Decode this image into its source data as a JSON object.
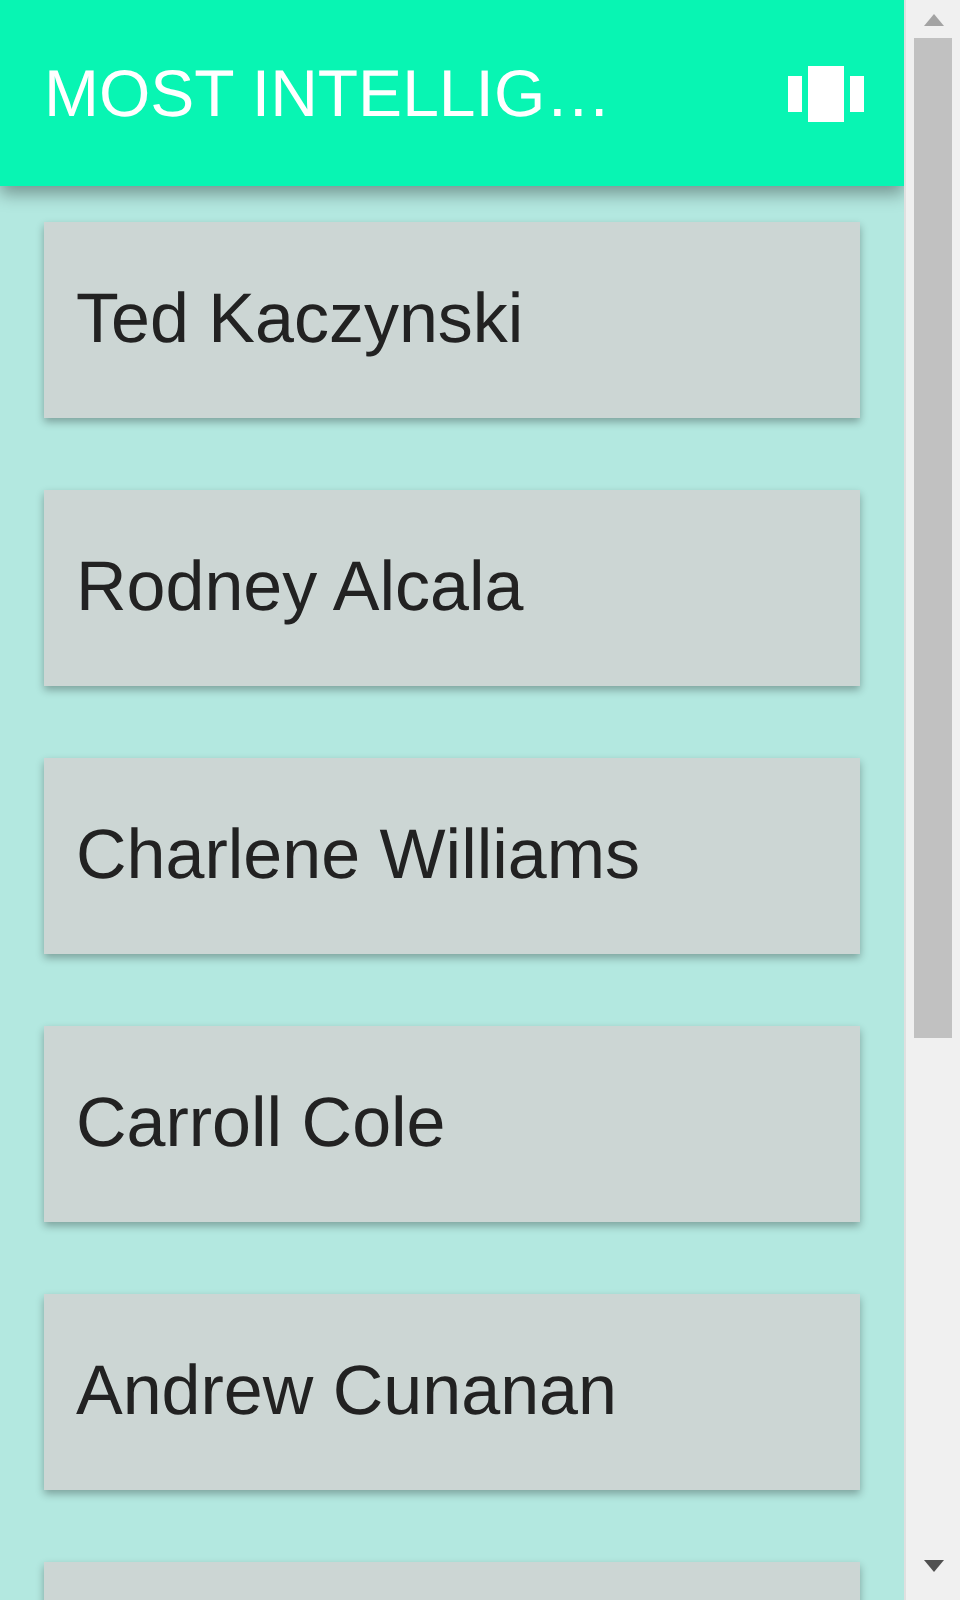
{
  "app_bar": {
    "title": "MOST INTELLIG…"
  },
  "items": [
    {
      "kind": "name",
      "name": "Ted Kaczynski"
    },
    {
      "kind": "name",
      "name": "Rodney Alcala"
    },
    {
      "kind": "name",
      "name": "Charlene Williams"
    },
    {
      "kind": "name",
      "name": "Carroll Cole"
    },
    {
      "kind": "name",
      "name": "Andrew Cunanan"
    },
    {
      "kind": "blank"
    }
  ]
}
